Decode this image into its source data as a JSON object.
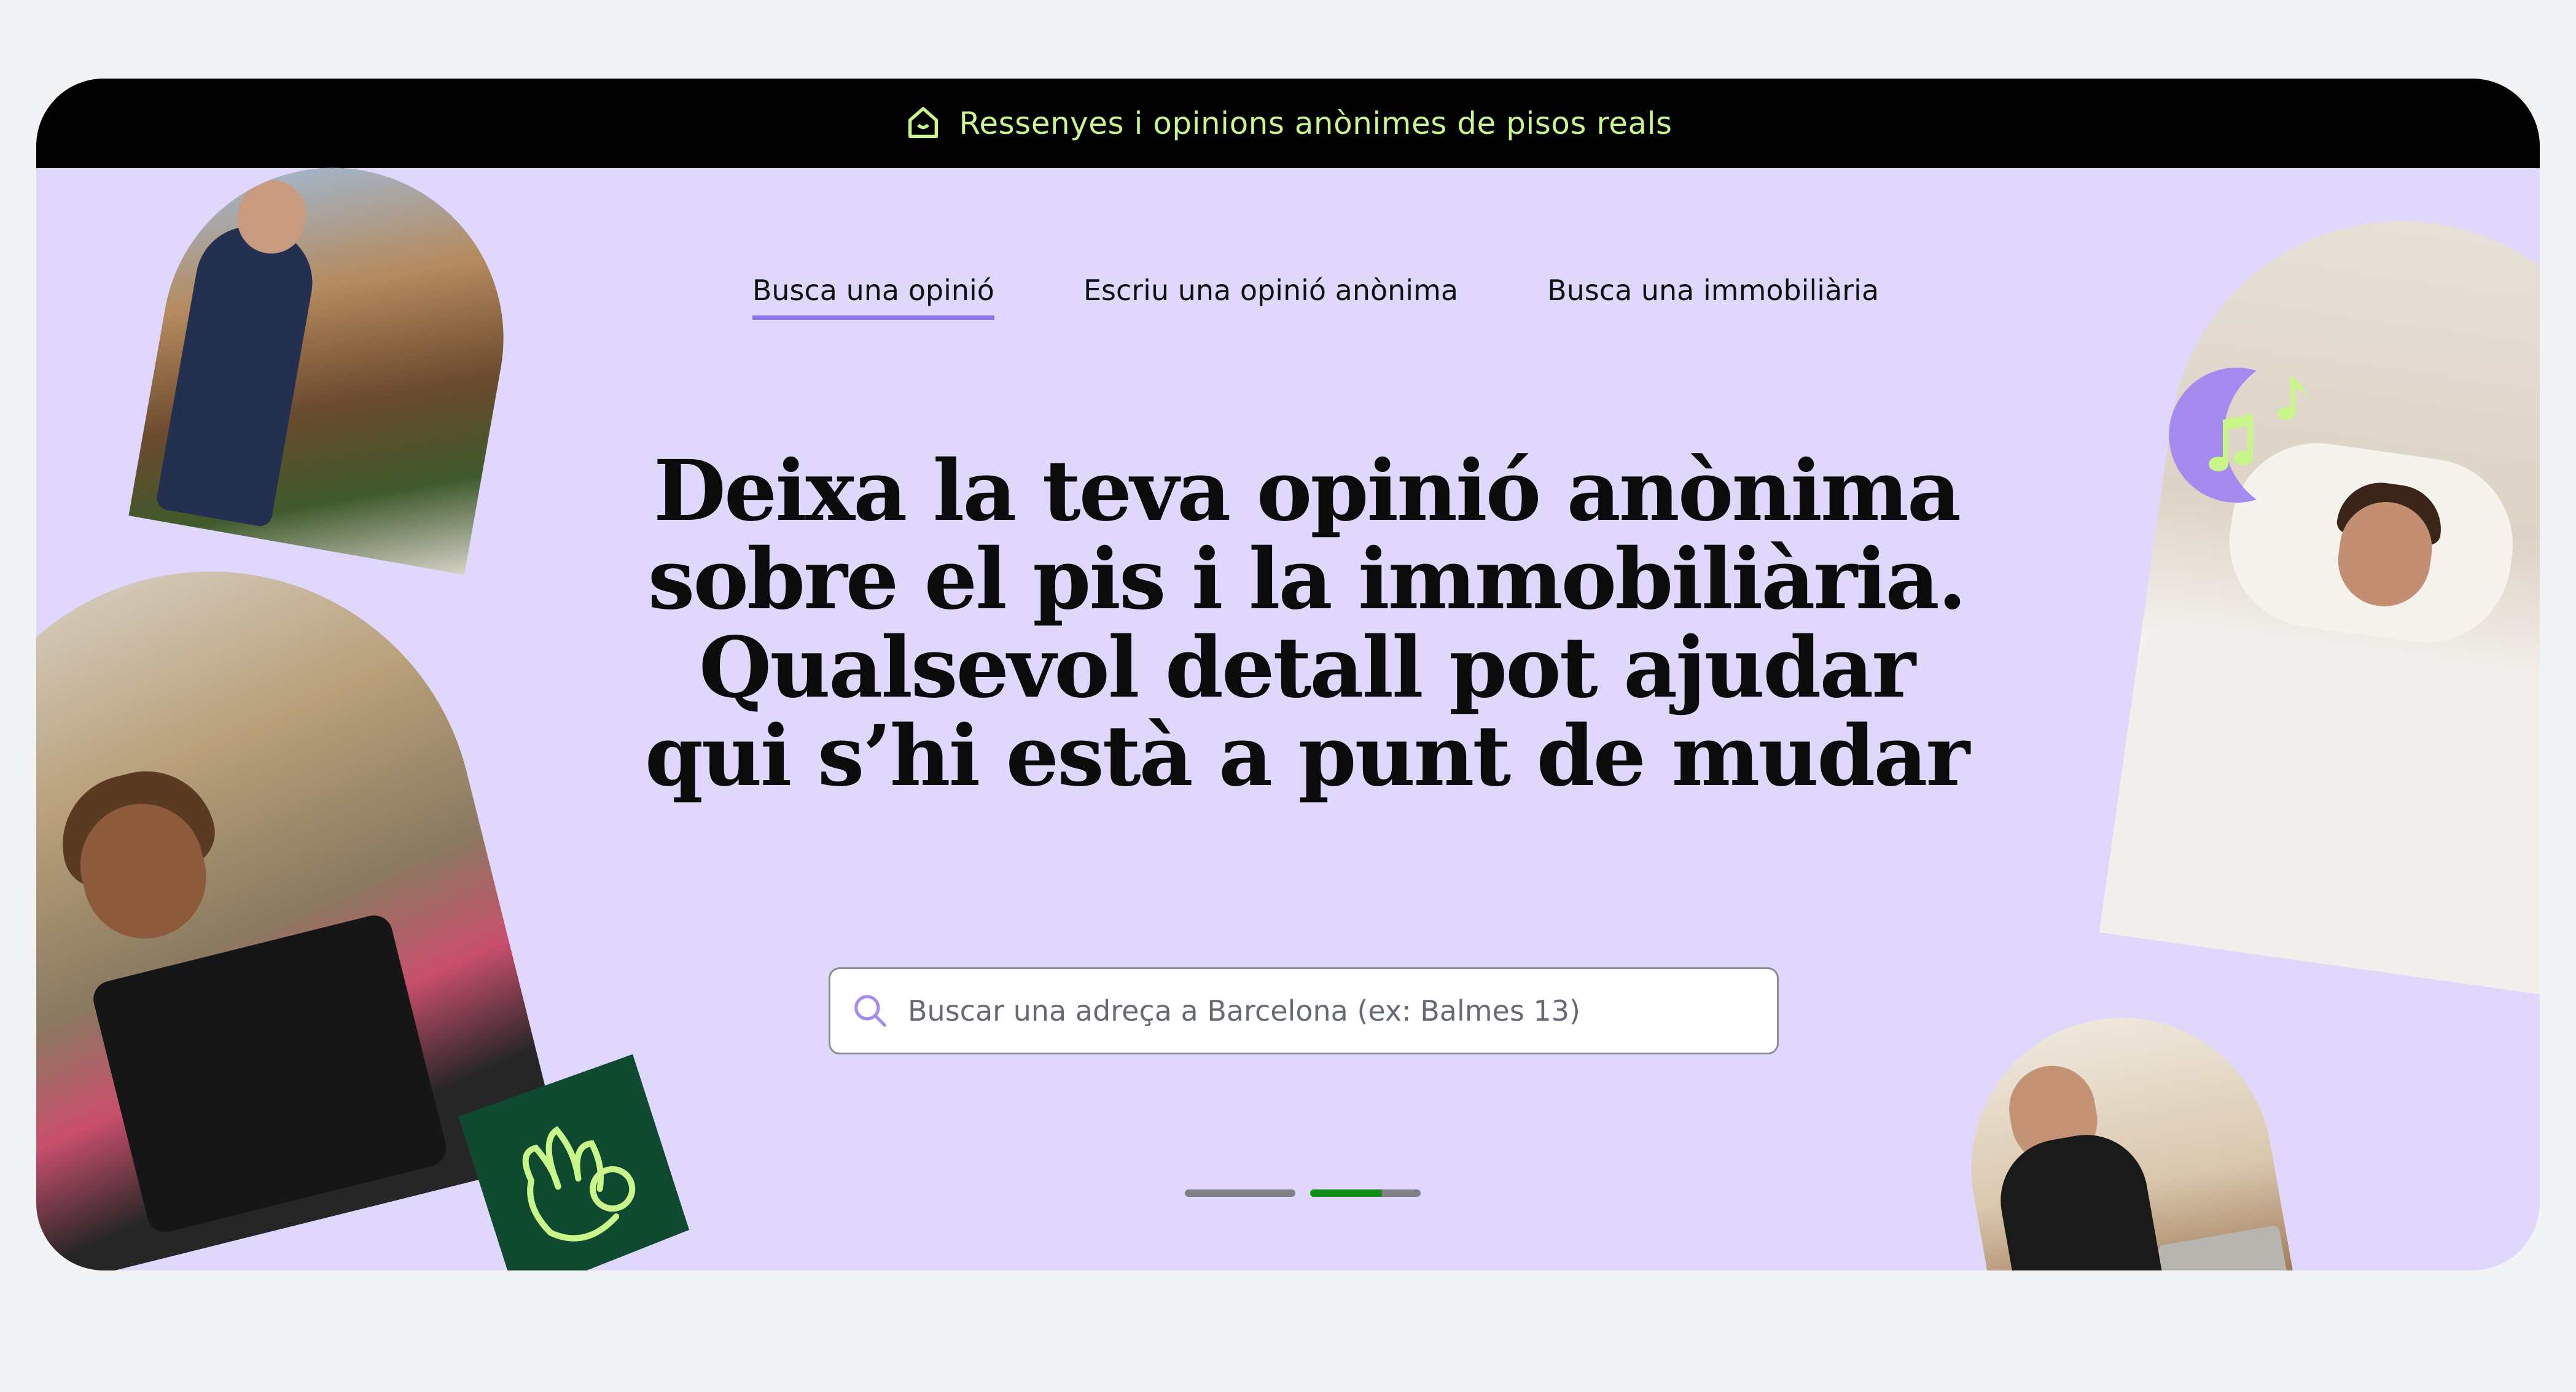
{
  "topbar": {
    "text": "Ressenyes i opinions anònimes de pisos reals",
    "icon": "home-icon",
    "accent": "#c9f58a"
  },
  "nav": {
    "items": [
      {
        "label": "Busca una opinió",
        "active": true
      },
      {
        "label": "Escriu una opinió anònima",
        "active": false
      },
      {
        "label": "Busca una immobiliària",
        "active": false
      }
    ]
  },
  "hero": {
    "lines": [
      "Deixa la teva opinió anònima",
      "sobre el pis i la immobiliària.",
      "Qualsevol detall pot ajudar",
      "qui s’hi està a punt de mudar"
    ]
  },
  "search": {
    "placeholder": "Buscar una adreça a Barcelona (ex: Balmes 13)",
    "icon": "search-icon"
  },
  "carousel": {
    "slides": 2,
    "active_index": 1,
    "progress": 0.65
  },
  "colors": {
    "background": "#e0d8fc",
    "page": "#f2f3f5",
    "underline": "#8a73e6",
    "progress": "#108e18",
    "badge": "#0f4a30",
    "moon": "#a58af0",
    "music_note": "#c9f58a"
  }
}
